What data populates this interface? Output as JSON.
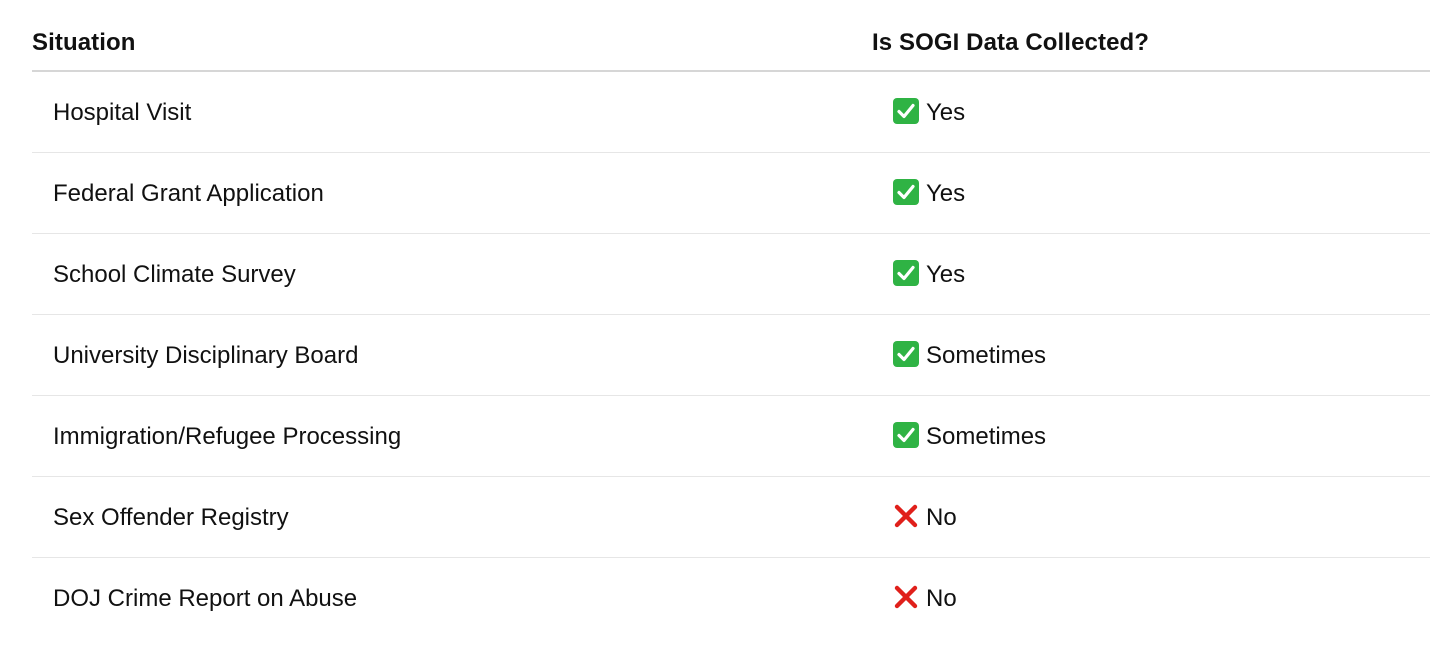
{
  "table": {
    "headers": {
      "situation": "Situation",
      "collected": "Is SOGI Data Collected?"
    },
    "rows": [
      {
        "situation": "Hospital Visit",
        "icon": "check-mark-icon",
        "status": "Yes"
      },
      {
        "situation": "Federal Grant Application",
        "icon": "check-mark-icon",
        "status": "Yes"
      },
      {
        "situation": "School Climate Survey",
        "icon": "check-mark-icon",
        "status": "Yes"
      },
      {
        "situation": "University Disciplinary Board",
        "icon": "check-mark-icon",
        "status": "Sometimes"
      },
      {
        "situation": "Immigration/Refugee Processing",
        "icon": "check-mark-icon",
        "status": "Sometimes"
      },
      {
        "situation": "Sex Offender Registry",
        "icon": "cross-mark-icon",
        "status": "No"
      },
      {
        "situation": "DOJ Crime Report on Abuse",
        "icon": "cross-mark-icon",
        "status": "No"
      }
    ]
  },
  "colors": {
    "check": "#2fb344",
    "cross": "#e0201b",
    "header_rule": "#d6d6d6",
    "row_rule": "#e6e6e6"
  }
}
